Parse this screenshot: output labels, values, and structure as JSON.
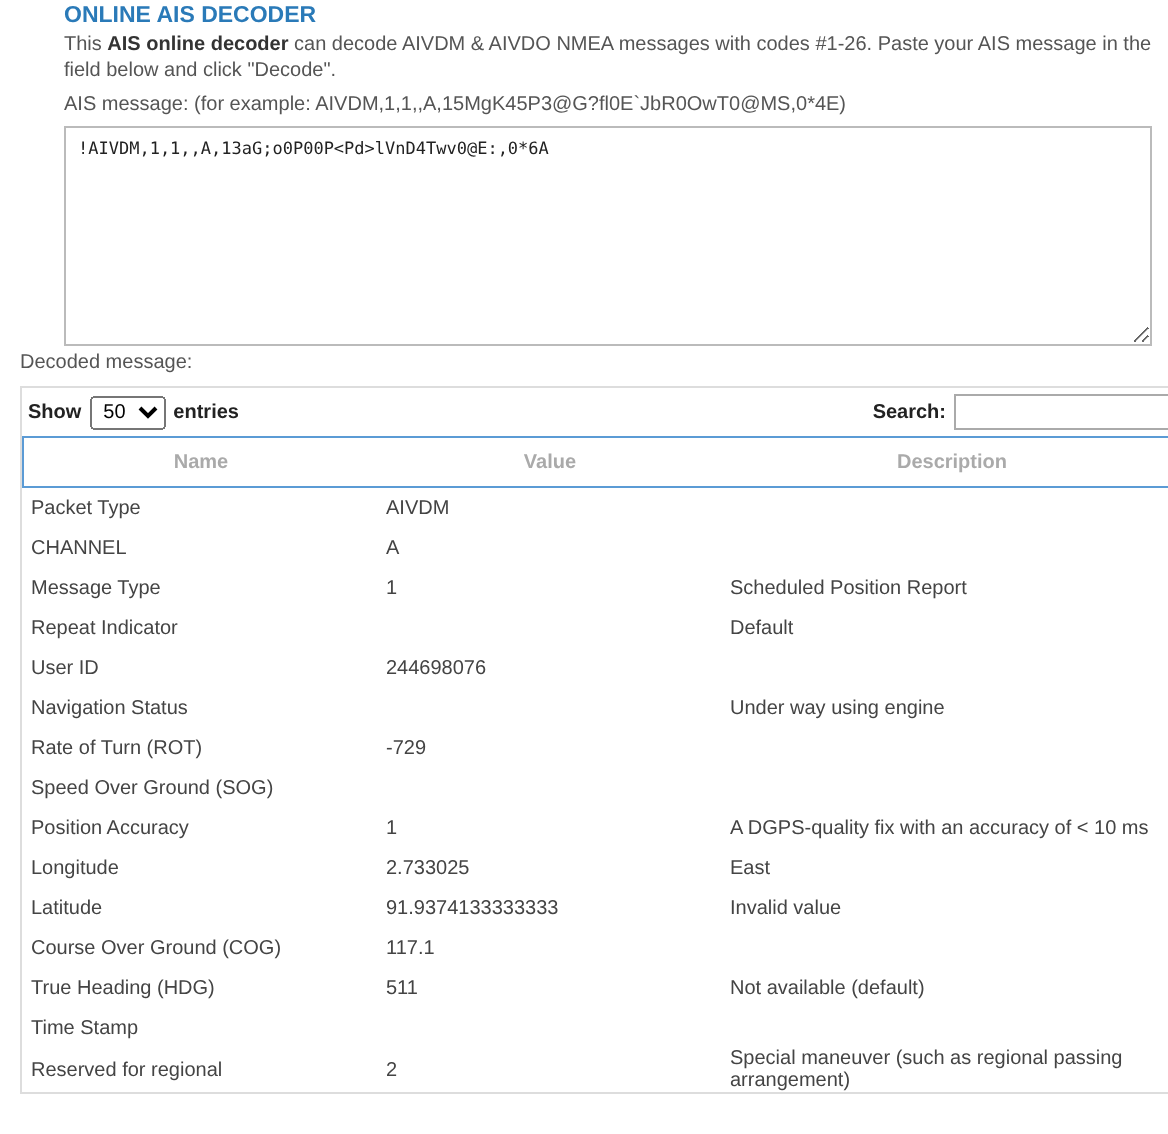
{
  "heading": "ONLINE AIS DECODER",
  "intro": "This **AIS online decoder** can decode AIVDM & AIVDO NMEA messages with codes #1-26. Paste your AIS message in the field below and click \"Decode\".",
  "message_label": "AIS message: (for example: AIVDM,1,1,,A,15MgK45P3@G?fl0E`JbR0OwT0@MS,0*4E)",
  "message_value": "!AIVDM,1,1,,A,13aG;o0P00P<Pd>lVnD4Twv0@E:,0*6A",
  "decoded_label": "Decoded message:",
  "length_control": {
    "before": "Show",
    "value": "50",
    "after": "entries"
  },
  "search": {
    "label": "Search:"
  },
  "table": {
    "columns": [
      "Name",
      "Value",
      "Description"
    ],
    "rows": [
      [
        "Packet Type",
        "AIVDM",
        ""
      ],
      [
        "CHANNEL",
        "A",
        ""
      ],
      [
        "Message Type",
        "1",
        "Scheduled Position Report"
      ],
      [
        "Repeat Indicator",
        "",
        "Default"
      ],
      [
        "User ID",
        "244698076",
        ""
      ],
      [
        "Navigation Status",
        "",
        "Under way using engine"
      ],
      [
        "Rate of Turn (ROT)",
        "-729",
        ""
      ],
      [
        "Speed Over Ground (SOG)",
        "",
        ""
      ],
      [
        "Position Accuracy",
        "1",
        "A DGPS-quality fix with an accuracy of < 10 ms"
      ],
      [
        "Longitude",
        "2.733025",
        "East"
      ],
      [
        "Latitude",
        "91.9374133333333",
        "Invalid value"
      ],
      [
        "Course Over Ground (COG)",
        "117.1",
        ""
      ],
      [
        "True Heading (HDG)",
        "511",
        "Not available (default)"
      ],
      [
        "Time Stamp",
        "",
        ""
      ],
      [
        "Reserved for regional",
        "2",
        "Special maneuver (such as regional passing arrangement)"
      ]
    ]
  }
}
